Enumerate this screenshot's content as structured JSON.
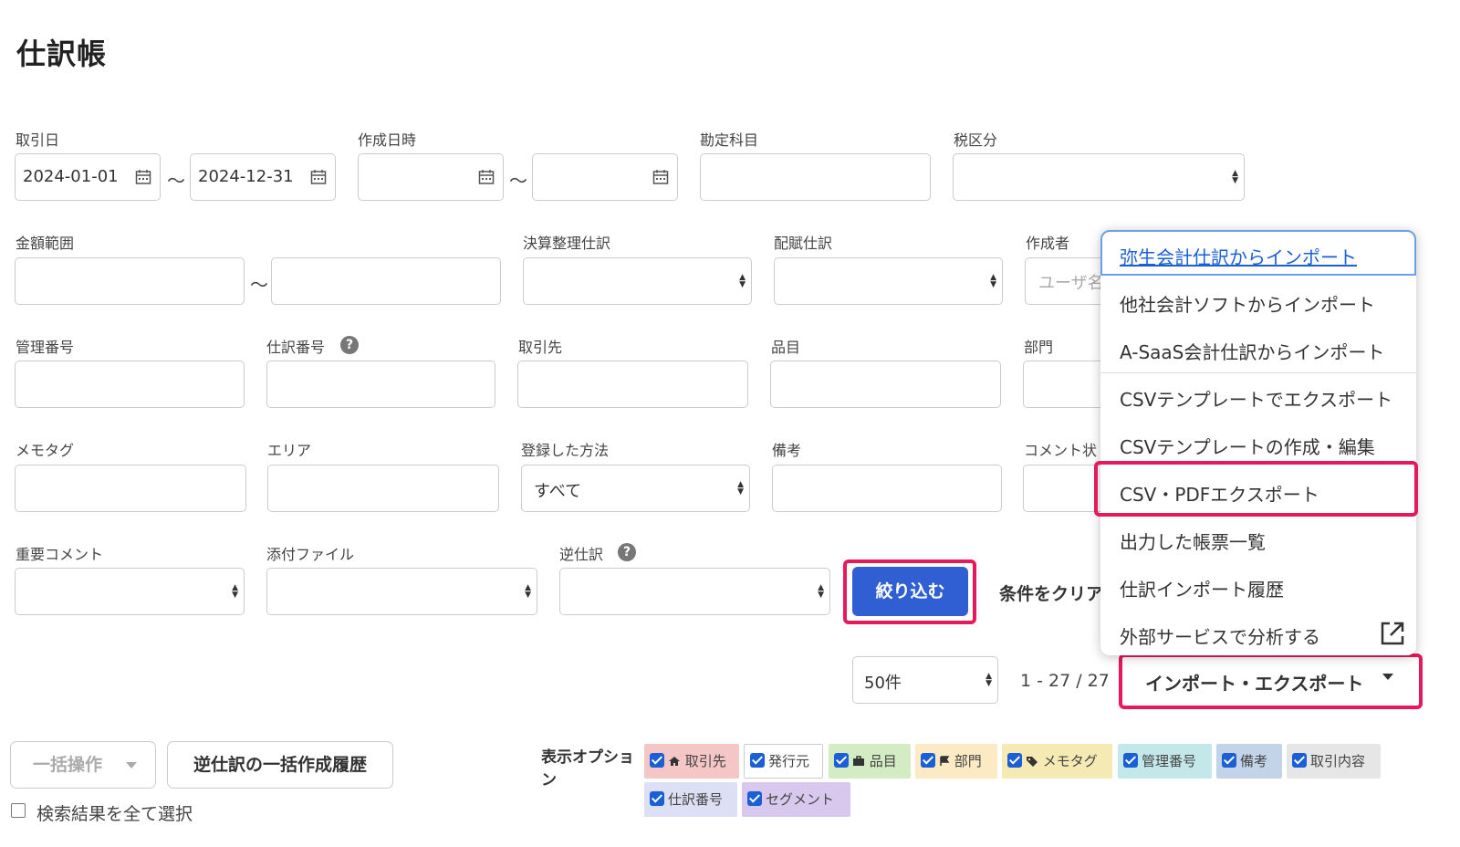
{
  "page": {
    "title": "仕訳帳"
  },
  "filters": {
    "torihikibi": {
      "label": "取引日",
      "from": "2024-01-01",
      "to": "2024-12-31"
    },
    "sakusei_nichiji": {
      "label": "作成日時"
    },
    "kanjo_kamoku": {
      "label": "勘定科目"
    },
    "zei_kubun": {
      "label": "税区分"
    },
    "kingaku_hani": {
      "label": "金額範囲"
    },
    "kessan_seiri": {
      "label": "決算整理仕訳"
    },
    "haifu_shiwake": {
      "label": "配賦仕訳"
    },
    "sakuseisha": {
      "label": "作成者",
      "placeholder": "ユーザ名"
    },
    "kanri_bango": {
      "label": "管理番号"
    },
    "shiwake_bango": {
      "label": "仕訳番号"
    },
    "torihikisaki": {
      "label": "取引先"
    },
    "hinmoku": {
      "label": "品目"
    },
    "bumon": {
      "label": "部門"
    },
    "memo_tag": {
      "label": "メモタグ"
    },
    "area": {
      "label": "エリア"
    },
    "toroku_hoho": {
      "label": "登録した方法",
      "value": "すべて"
    },
    "biko": {
      "label": "備考"
    },
    "comment": {
      "label": "コメント状"
    },
    "juyo_comment": {
      "label": "重要コメント"
    },
    "tenpu_file": {
      "label": "添付ファイル"
    },
    "gyaku_shiwake": {
      "label": "逆仕訳"
    },
    "tilde": "〜",
    "help_mark": "?"
  },
  "actions": {
    "filter_button": "絞り込む",
    "clear_button": "条件をクリア",
    "per_page": "50件",
    "range": "1 - 27 / 27",
    "import_export_button": "インポート・エクスポート",
    "bulk_button": "一括操作",
    "reverse_history_button": "逆仕訳の一括作成履歴",
    "select_all_label": "検索結果を全て選択"
  },
  "menu": {
    "items": [
      "弥生会計仕訳からインポート",
      "他社会計ソフトからインポート",
      "A-SaaS会計仕訳からインポート",
      "CSVテンプレートでエクスポート",
      "CSVテンプレートの作成・編集",
      "CSV・PDFエクスポート",
      "出力した帳票一覧",
      "仕訳インポート履歴",
      "外部サービスで分析する"
    ]
  },
  "display_options": {
    "label": "表示オプション",
    "chips": [
      {
        "label": "取引先",
        "icon": "home-icon",
        "color": "#f4c6c6"
      },
      {
        "label": "発行元",
        "icon": "",
        "color": "#ffffff"
      },
      {
        "label": "品目",
        "icon": "briefcase-icon",
        "color": "#d4ecc4"
      },
      {
        "label": "部門",
        "icon": "flag-icon",
        "color": "#fbeac4"
      },
      {
        "label": "メモタグ",
        "icon": "tag-icon",
        "color": "#f6eab4"
      },
      {
        "label": "管理番号",
        "icon": "",
        "color": "#c4e8ea"
      },
      {
        "label": "備考",
        "icon": "",
        "color": "#c4d4e8"
      },
      {
        "label": "取引内容",
        "icon": "",
        "color": "#e6e6e6"
      },
      {
        "label": "仕訳番号",
        "icon": "",
        "color": "#dde0f4"
      },
      {
        "label": "セグメント",
        "icon": "",
        "color": "#d8c8ee"
      }
    ]
  },
  "colors": {
    "primary": "#2f5fd3",
    "highlight": "#e8185c",
    "link": "#1a5fd6"
  }
}
